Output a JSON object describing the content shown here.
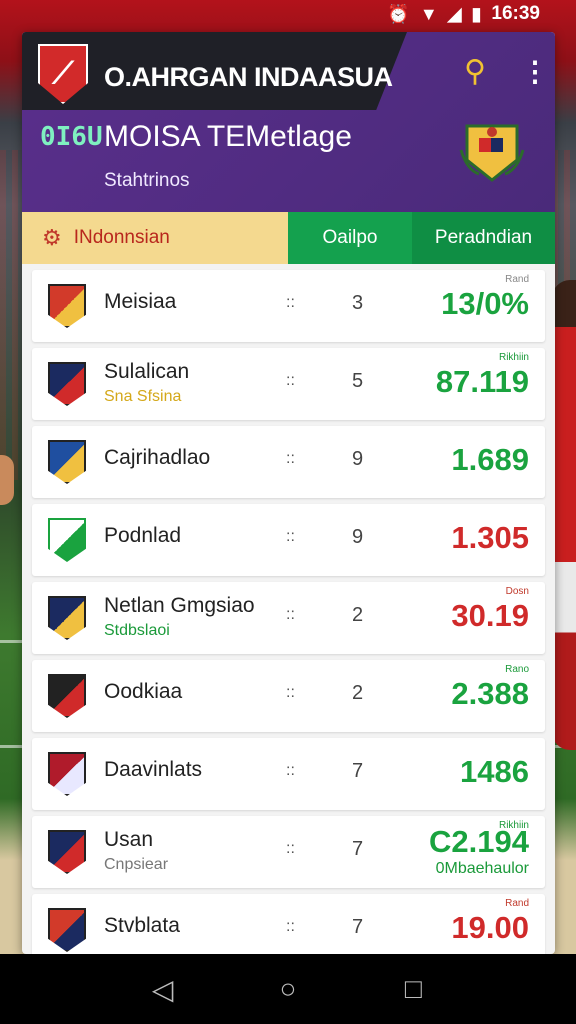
{
  "status_bar": {
    "time": "16:39",
    "icons": [
      "alarm-icon",
      "wifi-icon",
      "signal-icon",
      "battery-icon"
    ]
  },
  "header": {
    "app_title": "O.AHRGAN INDAASUA",
    "badge_code": "0I6U",
    "league_title": "MOISA TEMetlage",
    "league_sub": "Stahtrinos",
    "colors": {
      "header": "#5a2f8c",
      "topband": "#1f2027"
    }
  },
  "tabs": [
    {
      "label": "INdonnsian",
      "icon": "trophy-icon"
    },
    {
      "label": "Oailpo"
    },
    {
      "label": "Peradndian"
    }
  ],
  "rows": [
    {
      "name": "Meisiaa",
      "sub": "",
      "dots": "::",
      "num": "3",
      "tag": "Rand",
      "value": "13/0%",
      "value_color": "green",
      "value_sub": "",
      "badge": [
        "#d23a2a",
        "#f0c040"
      ]
    },
    {
      "name": "Sulalican",
      "sub": "Sna Sfsina",
      "sub_color": "gold",
      "dots": "::",
      "num": "5",
      "tag": "Rikhiin",
      "value": "87.119",
      "value_color": "green",
      "value_sub": "",
      "badge": [
        "#1b2a60",
        "#d02a2a"
      ]
    },
    {
      "name": "Cajrihadlao",
      "sub": "",
      "dots": "::",
      "num": "9",
      "tag": "",
      "value": "1.689",
      "value_color": "green",
      "value_sub": "",
      "badge": [
        "#1f4fa0",
        "#f0c040"
      ]
    },
    {
      "name": "Podnlad",
      "sub": "",
      "dots": "::",
      "num": "9",
      "tag": "",
      "value": "1.305",
      "value_color": "red",
      "value_sub": "",
      "badge": [
        "#ffffff",
        "#1aa33f"
      ]
    },
    {
      "name": "Netlan Gmgsiao",
      "sub": "Stdbslaoi",
      "sub_color": "green",
      "dots": "::",
      "num": "2",
      "tag": "Dosn",
      "value": "30.19",
      "value_color": "red",
      "value_sub": "",
      "badge": [
        "#1b2a60",
        "#f0c040"
      ]
    },
    {
      "name": "Oodkiaa",
      "sub": "",
      "dots": "::",
      "num": "2",
      "tag": "Rano",
      "value": "2.388",
      "value_color": "green",
      "value_sub": "",
      "badge": [
        "#222222",
        "#d02a2a"
      ]
    },
    {
      "name": "Daavinlats",
      "sub": "",
      "dots": "::",
      "num": "7",
      "tag": "",
      "value": "1486",
      "value_color": "green",
      "value_sub": "",
      "badge": [
        "#b01b2b",
        "#e8e8ff"
      ]
    },
    {
      "name": "Usan",
      "sub": "Cnpsiear",
      "sub_color": "gray",
      "dots": "::",
      "num": "7",
      "tag": "Rikhiin",
      "value": "C2.194",
      "value_color": "green",
      "value_sub": "0Mbaehaulor",
      "badge": [
        "#1b2a60",
        "#d02a2a"
      ]
    },
    {
      "name": "Stvblata",
      "sub": "",
      "dots": "::",
      "num": "7",
      "tag": "Rand",
      "value": "19.00",
      "value_color": "red",
      "value_sub": "",
      "badge": [
        "#d23a2a",
        "#1b2a60"
      ]
    }
  ],
  "navbar": {
    "back_icon": "◁",
    "home_icon": "○",
    "recents_icon": "□"
  }
}
